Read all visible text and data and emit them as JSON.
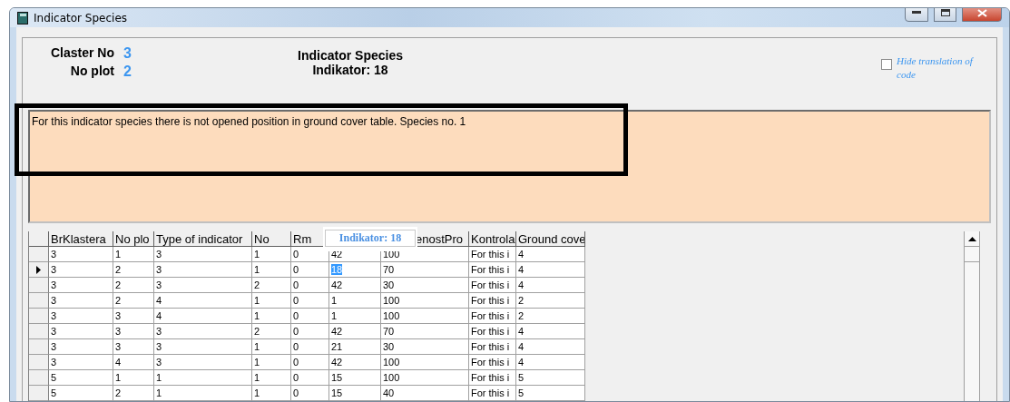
{
  "window": {
    "title": "Indicator Species"
  },
  "header": {
    "fields": [
      {
        "label": "Claster No",
        "value": "3"
      },
      {
        "label": "No plot",
        "value": "2"
      }
    ],
    "title": "Indicator Species",
    "subtitle": "Indikator: 18",
    "option": {
      "label": "Hide translation of code",
      "checked": false
    }
  },
  "message": "For this indicator species there is not opened position in ground cover table. Species no. 1",
  "tooltip": "Indikator: 18",
  "grid": {
    "columns": [
      "BrKlastera",
      "No plo",
      "Type of indicator",
      "No",
      "Rm",
      null,
      "enostPro",
      "Kontrola",
      "Ground cove"
    ],
    "rows": [
      {
        "selected": false,
        "cells": [
          {
            "text": "3",
            "selected": false
          },
          {
            "text": "1",
            "selected": false
          },
          {
            "text": "3",
            "selected": false
          },
          {
            "text": "1",
            "selected": false
          },
          {
            "text": "0",
            "selected": false
          },
          {
            "text": "42",
            "selected": false
          },
          {
            "text": "100",
            "selected": false
          },
          {
            "text": "For this i",
            "selected": false
          },
          {
            "text": "4",
            "selected": false
          }
        ]
      },
      {
        "selected": true,
        "cells": [
          {
            "text": "3",
            "selected": false
          },
          {
            "text": "2",
            "selected": false
          },
          {
            "text": "3",
            "selected": false
          },
          {
            "text": "1",
            "selected": false
          },
          {
            "text": "0",
            "selected": false
          },
          {
            "text": "18",
            "selected": true
          },
          {
            "text": "70",
            "selected": false
          },
          {
            "text": "For this i",
            "selected": false
          },
          {
            "text": "4",
            "selected": false
          }
        ]
      },
      {
        "selected": false,
        "cells": [
          {
            "text": "3",
            "selected": false
          },
          {
            "text": "2",
            "selected": false
          },
          {
            "text": "3",
            "selected": false
          },
          {
            "text": "2",
            "selected": false
          },
          {
            "text": "0",
            "selected": false
          },
          {
            "text": "42",
            "selected": false
          },
          {
            "text": "30",
            "selected": false
          },
          {
            "text": "For this i",
            "selected": false
          },
          {
            "text": "4",
            "selected": false
          }
        ]
      },
      {
        "selected": false,
        "cells": [
          {
            "text": "3",
            "selected": false
          },
          {
            "text": "2",
            "selected": false
          },
          {
            "text": "4",
            "selected": false
          },
          {
            "text": "1",
            "selected": false
          },
          {
            "text": "0",
            "selected": false
          },
          {
            "text": "1",
            "selected": false
          },
          {
            "text": "100",
            "selected": false
          },
          {
            "text": "For this i",
            "selected": false
          },
          {
            "text": "2",
            "selected": false
          }
        ]
      },
      {
        "selected": false,
        "cells": [
          {
            "text": "3",
            "selected": false
          },
          {
            "text": "3",
            "selected": false
          },
          {
            "text": "4",
            "selected": false
          },
          {
            "text": "1",
            "selected": false
          },
          {
            "text": "0",
            "selected": false
          },
          {
            "text": "1",
            "selected": false
          },
          {
            "text": "100",
            "selected": false
          },
          {
            "text": "For this i",
            "selected": false
          },
          {
            "text": "2",
            "selected": false
          }
        ]
      },
      {
        "selected": false,
        "cells": [
          {
            "text": "3",
            "selected": false
          },
          {
            "text": "3",
            "selected": false
          },
          {
            "text": "3",
            "selected": false
          },
          {
            "text": "2",
            "selected": false
          },
          {
            "text": "0",
            "selected": false
          },
          {
            "text": "42",
            "selected": false
          },
          {
            "text": "70",
            "selected": false
          },
          {
            "text": "For this i",
            "selected": false
          },
          {
            "text": "4",
            "selected": false
          }
        ]
      },
      {
        "selected": false,
        "cells": [
          {
            "text": "3",
            "selected": false
          },
          {
            "text": "3",
            "selected": false
          },
          {
            "text": "3",
            "selected": false
          },
          {
            "text": "1",
            "selected": false
          },
          {
            "text": "0",
            "selected": false
          },
          {
            "text": "21",
            "selected": false
          },
          {
            "text": "30",
            "selected": false
          },
          {
            "text": "For this i",
            "selected": false
          },
          {
            "text": "4",
            "selected": false
          }
        ]
      },
      {
        "selected": false,
        "cells": [
          {
            "text": "3",
            "selected": false
          },
          {
            "text": "4",
            "selected": false
          },
          {
            "text": "3",
            "selected": false
          },
          {
            "text": "1",
            "selected": false
          },
          {
            "text": "0",
            "selected": false
          },
          {
            "text": "42",
            "selected": false
          },
          {
            "text": "100",
            "selected": false
          },
          {
            "text": "For this i",
            "selected": false
          },
          {
            "text": "4",
            "selected": false
          }
        ]
      },
      {
        "selected": false,
        "cells": [
          {
            "text": "5",
            "selected": false
          },
          {
            "text": "1",
            "selected": false
          },
          {
            "text": "1",
            "selected": false
          },
          {
            "text": "1",
            "selected": false
          },
          {
            "text": "0",
            "selected": false
          },
          {
            "text": "15",
            "selected": false
          },
          {
            "text": "100",
            "selected": false
          },
          {
            "text": "For this i",
            "selected": false
          },
          {
            "text": "5",
            "selected": false
          }
        ]
      },
      {
        "selected": false,
        "cells": [
          {
            "text": "5",
            "selected": false
          },
          {
            "text": "2",
            "selected": false
          },
          {
            "text": "1",
            "selected": false
          },
          {
            "text": "1",
            "selected": false
          },
          {
            "text": "0",
            "selected": false
          },
          {
            "text": "15",
            "selected": false
          },
          {
            "text": "40",
            "selected": false
          },
          {
            "text": "For this i",
            "selected": false
          },
          {
            "text": "5",
            "selected": false
          }
        ]
      }
    ]
  }
}
